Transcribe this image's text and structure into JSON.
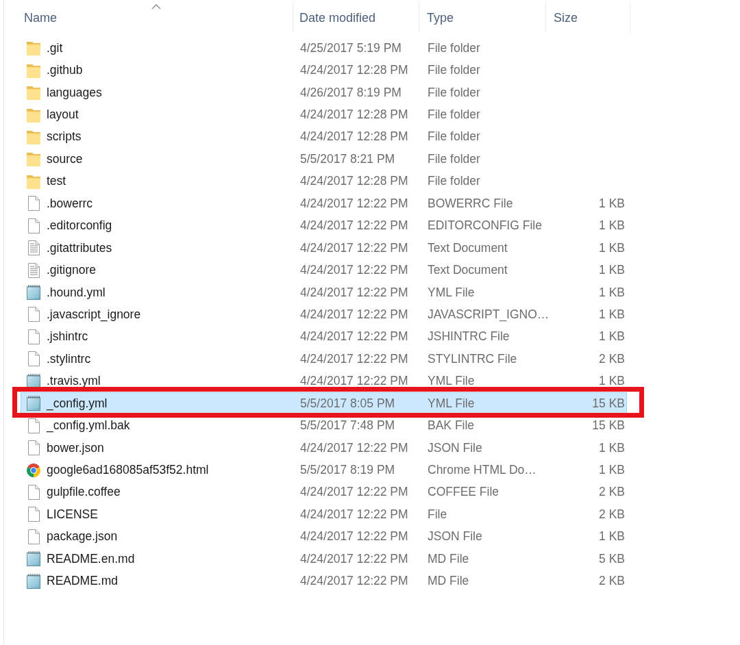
{
  "columns": [
    {
      "label": "Name",
      "sorted": true
    },
    {
      "label": "Date modified",
      "sorted": false
    },
    {
      "label": "Type",
      "sorted": false
    },
    {
      "label": "Size",
      "sorted": false
    }
  ],
  "rows": [
    {
      "kind": "folder",
      "name": ".git",
      "date": "4/25/2017 5:19 PM",
      "type": "File folder",
      "selected": false,
      "framed": false
    },
    {
      "kind": "folder",
      "name": ".github",
      "date": "4/24/2017 12:28 PM",
      "type": "File folder",
      "selected": false,
      "framed": false
    },
    {
      "kind": "folder",
      "name": "languages",
      "date": "4/26/2017 8:19 PM",
      "type": "File folder",
      "selected": false,
      "framed": false
    },
    {
      "kind": "folder",
      "name": "layout",
      "date": "4/24/2017 12:28 PM",
      "type": "File folder",
      "selected": false,
      "framed": false
    },
    {
      "kind": "folder",
      "name": "scripts",
      "date": "4/24/2017 12:28 PM",
      "type": "File folder",
      "selected": false,
      "framed": false
    },
    {
      "kind": "folder",
      "name": "source",
      "date": "5/5/2017 8:21 PM",
      "type": "File folder",
      "selected": false,
      "framed": false
    },
    {
      "kind": "folder",
      "name": "test",
      "date": "4/24/2017 12:28 PM",
      "type": "File folder",
      "selected": false,
      "framed": false
    },
    {
      "kind": "file",
      "name": ".bowerrc",
      "date": "4/24/2017 12:22 PM",
      "type": "BOWERRC File",
      "size": "1 KB",
      "selected": false,
      "framed": false
    },
    {
      "kind": "file",
      "name": ".editorconfig",
      "date": "4/24/2017 12:22 PM",
      "type": "EDITORCONFIG File",
      "size": "1 KB",
      "selected": false,
      "framed": false
    },
    {
      "kind": "text",
      "name": ".gitattributes",
      "date": "4/24/2017 12:22 PM",
      "type": "Text Document",
      "size": "1 KB",
      "selected": false,
      "framed": false
    },
    {
      "kind": "text",
      "name": ".gitignore",
      "date": "4/24/2017 12:22 PM",
      "type": "Text Document",
      "size": "1 KB",
      "selected": false,
      "framed": false
    },
    {
      "kind": "notepad",
      "name": ".hound.yml",
      "date": "4/24/2017 12:22 PM",
      "type": "YML File",
      "size": "1 KB",
      "selected": false,
      "framed": false
    },
    {
      "kind": "file",
      "name": ".javascript_ignore",
      "date": "4/24/2017 12:22 PM",
      "type": "JAVASCRIPT_IGNO…",
      "size": "1 KB",
      "selected": false,
      "framed": false
    },
    {
      "kind": "file",
      "name": ".jshintrc",
      "date": "4/24/2017 12:22 PM",
      "type": "JSHINTRC File",
      "size": "1 KB",
      "selected": false,
      "framed": false
    },
    {
      "kind": "file",
      "name": ".stylintrc",
      "date": "4/24/2017 12:22 PM",
      "type": "STYLINTRC File",
      "size": "2 KB",
      "selected": false,
      "framed": false
    },
    {
      "kind": "notepad",
      "name": ".travis.yml",
      "date": "4/24/2017 12:22 PM",
      "type": "YML File",
      "size": "1 KB",
      "selected": false,
      "framed": false
    },
    {
      "kind": "notepad",
      "name": "_config.yml",
      "date": "5/5/2017 8:05 PM",
      "type": "YML File",
      "size": "15 KB",
      "selected": true,
      "framed": true
    },
    {
      "kind": "file",
      "name": "_config.yml.bak",
      "date": "5/5/2017 7:48 PM",
      "type": "BAK File",
      "size": "15 KB",
      "selected": false,
      "framed": false
    },
    {
      "kind": "file",
      "name": "bower.json",
      "date": "4/24/2017 12:22 PM",
      "type": "JSON File",
      "size": "1 KB",
      "selected": false,
      "framed": false
    },
    {
      "kind": "browser",
      "name": "google6ad168085af53f52.html",
      "date": "5/5/2017 8:19 PM",
      "type": "Chrome HTML Do…",
      "size": "1 KB",
      "selected": false,
      "framed": false
    },
    {
      "kind": "file",
      "name": "gulpfile.coffee",
      "date": "4/24/2017 12:22 PM",
      "type": "COFFEE File",
      "size": "2 KB",
      "selected": false,
      "framed": false
    },
    {
      "kind": "file",
      "name": "LICENSE",
      "date": "4/24/2017 12:22 PM",
      "type": "File",
      "size": "2 KB",
      "selected": false,
      "framed": false
    },
    {
      "kind": "file",
      "name": "package.json",
      "date": "4/24/2017 12:22 PM",
      "type": "JSON File",
      "size": "1 KB",
      "selected": false,
      "framed": false
    },
    {
      "kind": "notepad",
      "name": "README.en.md",
      "date": "4/24/2017 12:22 PM",
      "type": "MD File",
      "size": "5 KB",
      "selected": false,
      "framed": false
    },
    {
      "kind": "notepad",
      "name": "README.md",
      "date": "4/24/2017 12:22 PM",
      "type": "MD File",
      "size": "2 KB",
      "selected": false,
      "framed": false
    }
  ]
}
